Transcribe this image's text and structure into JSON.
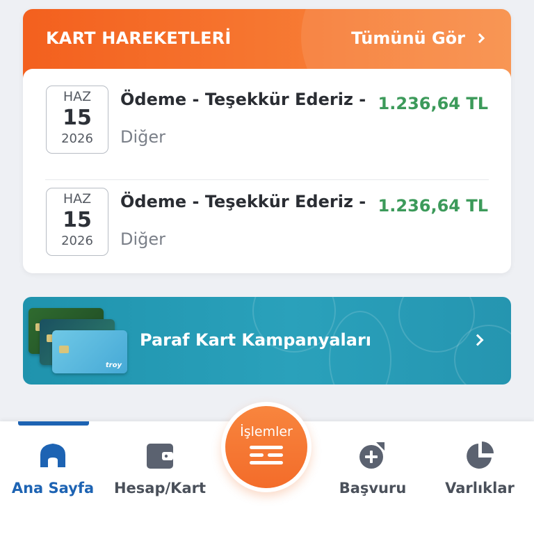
{
  "card_movements": {
    "title": "KART HAREKETLERİ",
    "see_all": "Tümünü Gör",
    "transactions": [
      {
        "month": "HAZ",
        "day": "15",
        "year": "2026",
        "title": "Ödeme - Teşekkür Ederiz -",
        "category": "Diğer",
        "amount": "1.236,64 TL"
      },
      {
        "month": "HAZ",
        "day": "15",
        "year": "2026",
        "title": "Ödeme - Teşekkür Ederiz -",
        "category": "Diğer",
        "amount": "1.236,64 TL"
      }
    ]
  },
  "banner": {
    "label": "Paraf Kart Kampanyaları",
    "card_brand": "troy"
  },
  "bottom_nav": {
    "items": [
      {
        "label": "Ana Sayfa",
        "icon": "home-icon",
        "active": true
      },
      {
        "label": "Hesap/Kart",
        "icon": "wallet-icon",
        "active": false
      },
      {
        "label": "Başvuru",
        "icon": "add-document-icon",
        "active": false
      },
      {
        "label": "Varlıklar",
        "icon": "pie-chart-icon",
        "active": false
      }
    ],
    "fab": {
      "label": "İşlemler",
      "icon": "transactions-icon"
    }
  },
  "colors": {
    "header_orange": "#f3601e",
    "amount_green": "#3c9a5a",
    "banner_teal": "#2aa1bb",
    "nav_active": "#1d63b3",
    "nav_icon": "#5b6270"
  }
}
